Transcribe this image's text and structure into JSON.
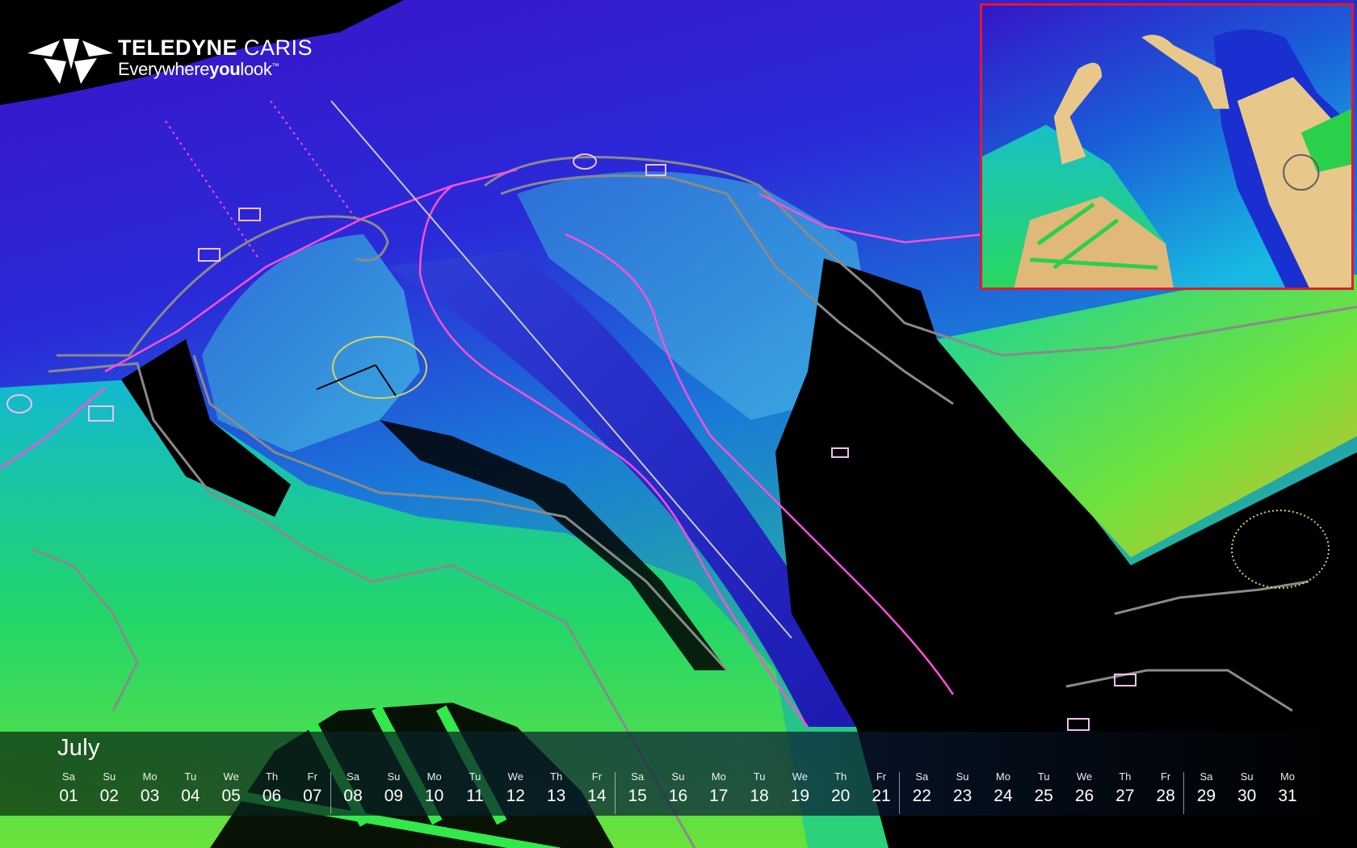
{
  "brand": {
    "name_bold": "TELEDYNE",
    "name_light": " CARIS",
    "tagline_pre": "Everywhere",
    "tagline_bold": "you",
    "tagline_post": "look",
    "tagline_mark": "™"
  },
  "calendar": {
    "month": "July",
    "days": [
      {
        "dow": "Sa",
        "num": "01"
      },
      {
        "dow": "Su",
        "num": "02"
      },
      {
        "dow": "Mo",
        "num": "03"
      },
      {
        "dow": "Tu",
        "num": "04"
      },
      {
        "dow": "We",
        "num": "05"
      },
      {
        "dow": "Th",
        "num": "06"
      },
      {
        "dow": "Fr",
        "num": "07"
      },
      {
        "dow": "Sa",
        "num": "08"
      },
      {
        "dow": "Su",
        "num": "09"
      },
      {
        "dow": "Mo",
        "num": "10"
      },
      {
        "dow": "Tu",
        "num": "11"
      },
      {
        "dow": "We",
        "num": "12"
      },
      {
        "dow": "Th",
        "num": "13"
      },
      {
        "dow": "Fr",
        "num": "14"
      },
      {
        "dow": "Sa",
        "num": "15"
      },
      {
        "dow": "Su",
        "num": "16"
      },
      {
        "dow": "Mo",
        "num": "17"
      },
      {
        "dow": "Tu",
        "num": "18"
      },
      {
        "dow": "We",
        "num": "19"
      },
      {
        "dow": "Th",
        "num": "20"
      },
      {
        "dow": "Fr",
        "num": "21"
      },
      {
        "dow": "Sa",
        "num": "22"
      },
      {
        "dow": "Su",
        "num": "23"
      },
      {
        "dow": "Mo",
        "num": "24"
      },
      {
        "dow": "Tu",
        "num": "25"
      },
      {
        "dow": "We",
        "num": "26"
      },
      {
        "dow": "Th",
        "num": "27"
      },
      {
        "dow": "Fr",
        "num": "28"
      },
      {
        "dow": "Sa",
        "num": "29"
      },
      {
        "dow": "Su",
        "num": "30"
      },
      {
        "dow": "Mo",
        "num": "31"
      }
    ]
  },
  "colors": {
    "deep": "#2a0fd0",
    "mid": "#1b6fe0",
    "shallow": "#2fd46a",
    "land": "#e8c88a",
    "inset_border": "#e3192b",
    "chart_line": "#8a8a8a",
    "route": "#ff4fd8"
  }
}
